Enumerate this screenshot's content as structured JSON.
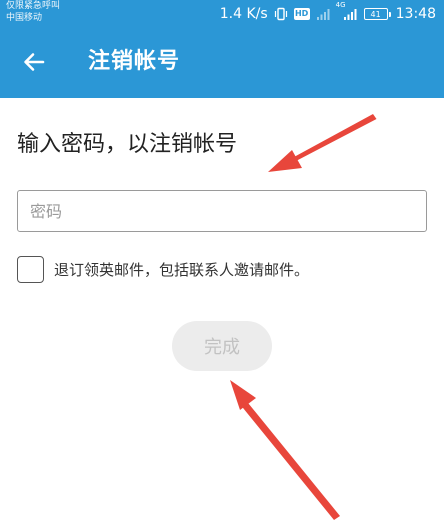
{
  "status_bar": {
    "line1": "仅限紧急呼叫",
    "line2": "中国移动",
    "speed": "1.4 K/s",
    "hd": "HD",
    "network": "4G",
    "battery": "41",
    "time": "13:48"
  },
  "app_bar": {
    "title": "注销帐号"
  },
  "main": {
    "heading": "输入密码，以注销帐号",
    "password_placeholder": "密码",
    "unsubscribe_label": "退订领英邮件，包括联系人邀请邮件。",
    "done_label": "完成"
  },
  "colors": {
    "header_blue": "#2b97d6",
    "annotation_red": "#e8463b",
    "disabled_button_bg": "#ececec",
    "disabled_button_text": "#c2c2c2"
  }
}
